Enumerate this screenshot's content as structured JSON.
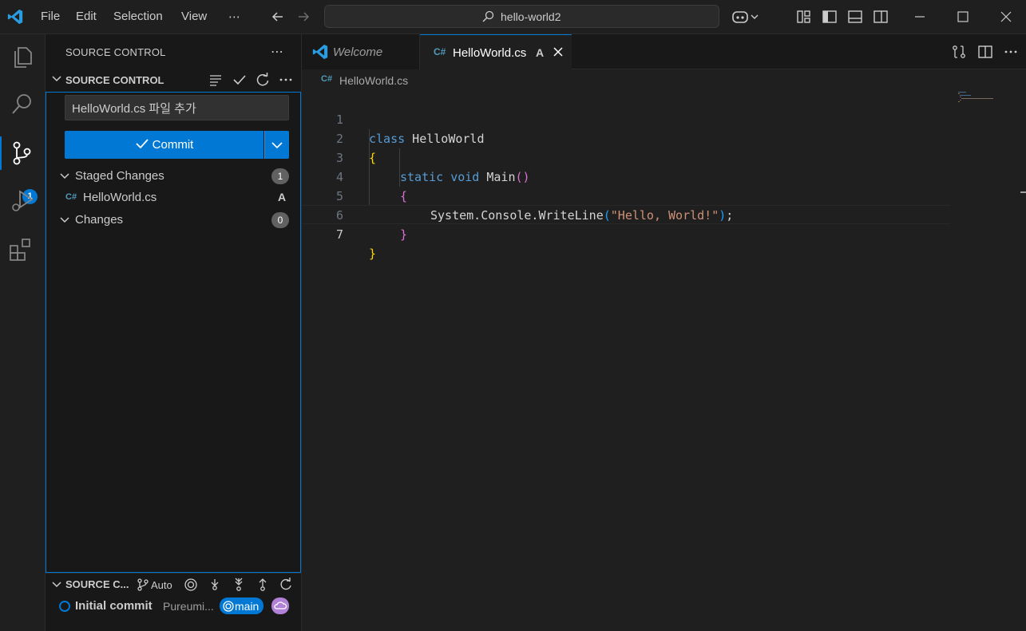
{
  "titlebar": {
    "menu": [
      "File",
      "Edit",
      "Selection",
      "View",
      "⋯"
    ],
    "search_text": "hello-world2"
  },
  "activity": {
    "scm_badge": "1"
  },
  "sidebar": {
    "title": "SOURCE CONTROL",
    "more": "⋯",
    "section_title": "SOURCE CONTROL",
    "commit_message": "HelloWorld.cs 파일 추가",
    "commit_label": "Commit",
    "staged": {
      "label": "Staged Changes",
      "count": "1",
      "files": [
        {
          "name": "HelloWorld.cs",
          "status": "A"
        }
      ]
    },
    "changes": {
      "label": "Changes",
      "count": "0"
    }
  },
  "graph": {
    "title": "SOURCE C...",
    "auto_label": "Auto",
    "commit_message": "Initial commit",
    "author": "Pureumi...",
    "branch": "main"
  },
  "editor": {
    "tabs": [
      {
        "label": "Welcome"
      },
      {
        "label": "HelloWorld.cs",
        "status": "A"
      }
    ],
    "breadcrumb": "HelloWorld.cs",
    "file_icon": "C#",
    "line_numbers": [
      "1",
      "2",
      "3",
      "4",
      "5",
      "6",
      "7"
    ],
    "code": {
      "l1_kw": "class",
      "l1_name": " HelloWorld",
      "l2": "{",
      "l3_kw": "static void",
      "l3_name": " Main",
      "l3_paren_open": "(",
      "l3_paren_close": ")",
      "l4": "{",
      "l5_pre": "System.Console.WriteLine",
      "l5_open": "(",
      "l5_str": "\"Hello, World!\"",
      "l5_close": ")",
      "l5_semi": ";",
      "l6": "}",
      "l7": "}"
    }
  },
  "colors": {
    "accent": "#0078d4",
    "keyword": "#569cd6",
    "string": "#ce9178"
  }
}
